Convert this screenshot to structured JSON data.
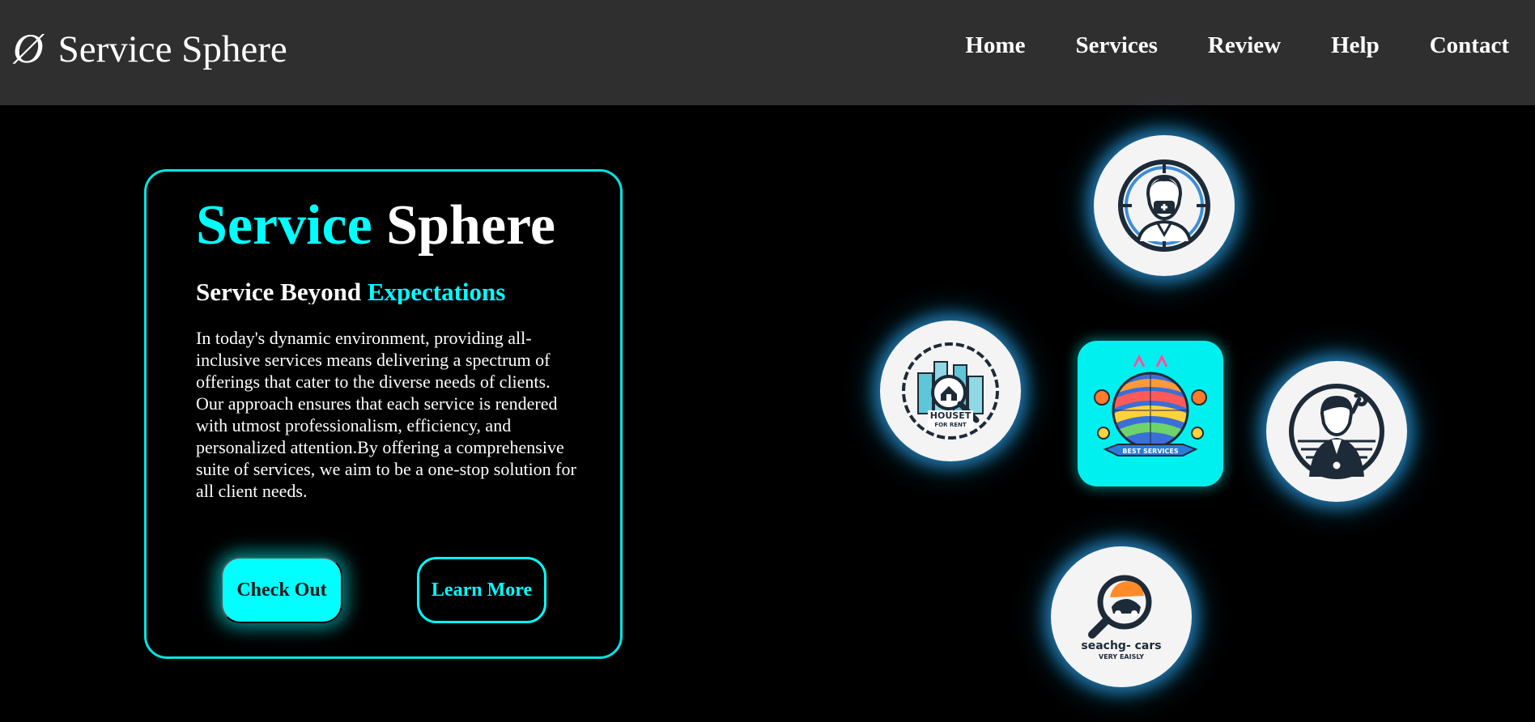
{
  "header": {
    "logo_glyph": "Ø",
    "brand": "Service Sphere",
    "nav": [
      "Home",
      "Services",
      "Review",
      "Help",
      "Contact"
    ]
  },
  "hero": {
    "title_accent": "Service",
    "title_rest": "Sphere",
    "tagline_plain": "Service Beyond",
    "tagline_accent": "Expectations",
    "description": "In today's dynamic environment, providing all-inclusive services means delivering a spectrum of offerings that cater to the diverse needs of clients. Our approach ensures that each service is rendered with utmost professionalism, efficiency, and personalized attention.By offering a comprehensive suite of services, we aim to be a one-stop solution for all client needs.",
    "primary_button": "Check Out",
    "secondary_button": "Learn More"
  },
  "services": {
    "doctor": {
      "icon": "doctor-icon"
    },
    "house": {
      "icon": "house-rent-icon",
      "line1": "HOUSET",
      "line2": "FOR RENT"
    },
    "center": {
      "icon": "globe-best-services-icon",
      "banner": "BEST SERVICES"
    },
    "mechanic": {
      "icon": "mechanic-icon"
    },
    "cars": {
      "icon": "search-cars-icon",
      "line1": "seachg- cars",
      "line2": "VERY EAISLY"
    }
  },
  "colors": {
    "accent": "#00ffff",
    "header_bg": "#302f30",
    "page_bg": "#000000"
  }
}
